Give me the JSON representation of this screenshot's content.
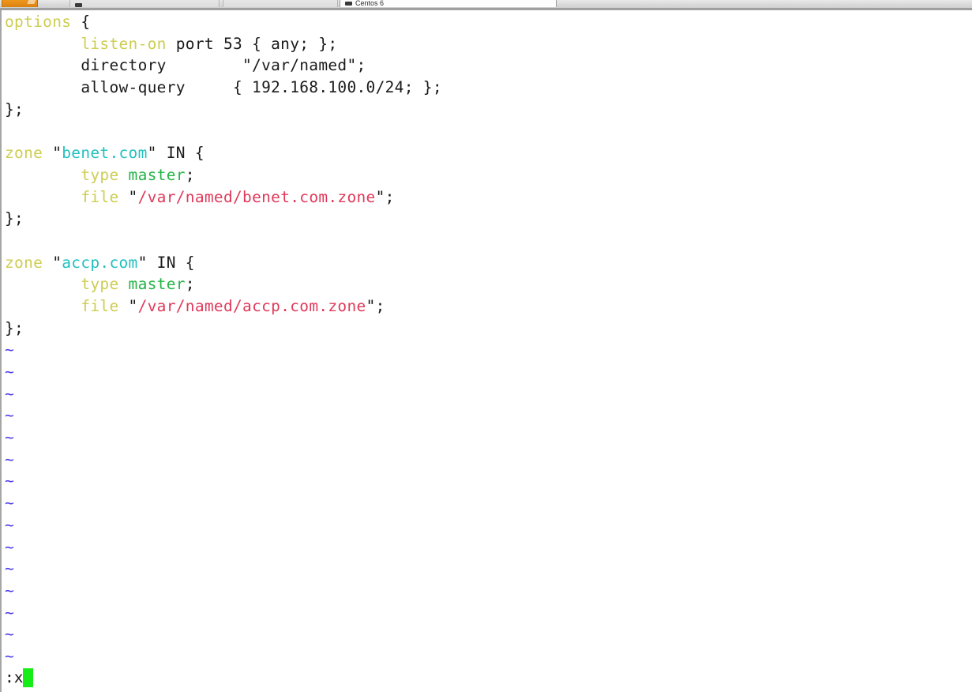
{
  "window": {
    "app_icon": "terminal-icon",
    "tabs": [
      {
        "label": "",
        "glyph": "terminal-glyph",
        "active": false
      },
      {
        "label": "",
        "glyph": "",
        "active": false
      },
      {
        "label": "Centos 6",
        "glyph": "terminal-glyph",
        "active": true
      }
    ]
  },
  "editor": {
    "mode": "command",
    "filetype": "named.conf",
    "colors": {
      "keyword": "#cdcd53",
      "string": "#23c0c0",
      "identifier": "#23b446",
      "path": "#e03a5a",
      "plain": "#1a1a1a",
      "tilde": "#4b3ce8",
      "cursor": "#16ec16",
      "background": "#ffffff"
    },
    "lines": [
      {
        "indent": 0,
        "tokens": [
          {
            "t": "options",
            "c": "kw"
          },
          {
            "t": " {",
            "c": "plain"
          }
        ]
      },
      {
        "indent": 1,
        "tokens": [
          {
            "t": "listen-on",
            "c": "kw"
          },
          {
            "t": " port 53 { any; };",
            "c": "plain"
          }
        ]
      },
      {
        "indent": 1,
        "tokens": [
          {
            "t": "directory",
            "c": "plain"
          },
          {
            "t": "        \"/var/named\";",
            "c": "plain"
          }
        ]
      },
      {
        "indent": 1,
        "tokens": [
          {
            "t": "allow-query",
            "c": "plain"
          },
          {
            "t": "     { 192.168.100.0/24; };",
            "c": "plain"
          }
        ]
      },
      {
        "indent": 0,
        "tokens": [
          {
            "t": "};",
            "c": "plain"
          }
        ]
      },
      {
        "indent": 0,
        "tokens": []
      },
      {
        "indent": 0,
        "tokens": [
          {
            "t": "zone",
            "c": "kw"
          },
          {
            "t": " \"",
            "c": "plain"
          },
          {
            "t": "benet.com",
            "c": "str"
          },
          {
            "t": "\" IN {",
            "c": "plain"
          }
        ]
      },
      {
        "indent": 1,
        "tokens": [
          {
            "t": "type",
            "c": "kw"
          },
          {
            "t": " ",
            "c": "plain"
          },
          {
            "t": "master",
            "c": "ident"
          },
          {
            "t": ";",
            "c": "plain"
          }
        ]
      },
      {
        "indent": 1,
        "tokens": [
          {
            "t": "file",
            "c": "kw"
          },
          {
            "t": " \"",
            "c": "plain"
          },
          {
            "t": "/var/named/benet.com.zone",
            "c": "path"
          },
          {
            "t": "\";",
            "c": "plain"
          }
        ]
      },
      {
        "indent": 0,
        "tokens": [
          {
            "t": "};",
            "c": "plain"
          }
        ]
      },
      {
        "indent": 0,
        "tokens": []
      },
      {
        "indent": 0,
        "tokens": [
          {
            "t": "zone",
            "c": "kw"
          },
          {
            "t": " \"",
            "c": "plain"
          },
          {
            "t": "accp.com",
            "c": "str"
          },
          {
            "t": "\" IN {",
            "c": "plain"
          }
        ]
      },
      {
        "indent": 1,
        "tokens": [
          {
            "t": "type",
            "c": "kw"
          },
          {
            "t": " ",
            "c": "plain"
          },
          {
            "t": "master",
            "c": "ident"
          },
          {
            "t": ";",
            "c": "plain"
          }
        ]
      },
      {
        "indent": 1,
        "tokens": [
          {
            "t": "file",
            "c": "kw"
          },
          {
            "t": " \"",
            "c": "plain"
          },
          {
            "t": "/var/named/accp.com.zone",
            "c": "path"
          },
          {
            "t": "\";",
            "c": "plain"
          }
        ]
      },
      {
        "indent": 0,
        "tokens": [
          {
            "t": "};",
            "c": "plain"
          }
        ]
      }
    ],
    "empty_line_marker": "~",
    "empty_line_count": 15,
    "command_line": ":x"
  }
}
